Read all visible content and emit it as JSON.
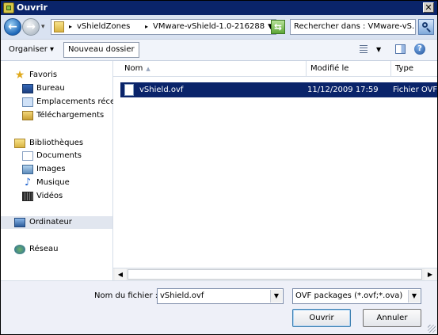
{
  "window": {
    "title": "Ouvrir",
    "close_glyph": "✕"
  },
  "address": {
    "breadcrumbs": [
      "vShieldZones",
      "VMware-vShield-1.0-216288"
    ],
    "search_placeholder": "Rechercher dans : VMware-vS..."
  },
  "toolbar": {
    "organise_label": "Organiser ▾",
    "new_folder_label": "Nouveau dossier"
  },
  "sidebar": {
    "favorites_label": "Favoris",
    "favorites": [
      "Bureau",
      "Emplacements récents",
      "Téléchargements"
    ],
    "libraries_label": "Bibliothèques",
    "libraries": [
      "Documents",
      "Images",
      "Musique",
      "Vidéos"
    ],
    "computer_label": "Ordinateur",
    "network_label": "Réseau"
  },
  "columns": {
    "name": "Nom",
    "modified": "Modifié le",
    "type": "Type"
  },
  "files": [
    {
      "name": "vShield.ovf",
      "modified": "11/12/2009 17:59",
      "type": "Fichier OVF"
    }
  ],
  "footer": {
    "filename_label": "Nom du fichier :",
    "filename_value": "vShield.ovf",
    "filter_value": "OVF packages (*.ovf;*.ova)",
    "open_label": "Ouvrir",
    "cancel_label": "Annuler"
  }
}
